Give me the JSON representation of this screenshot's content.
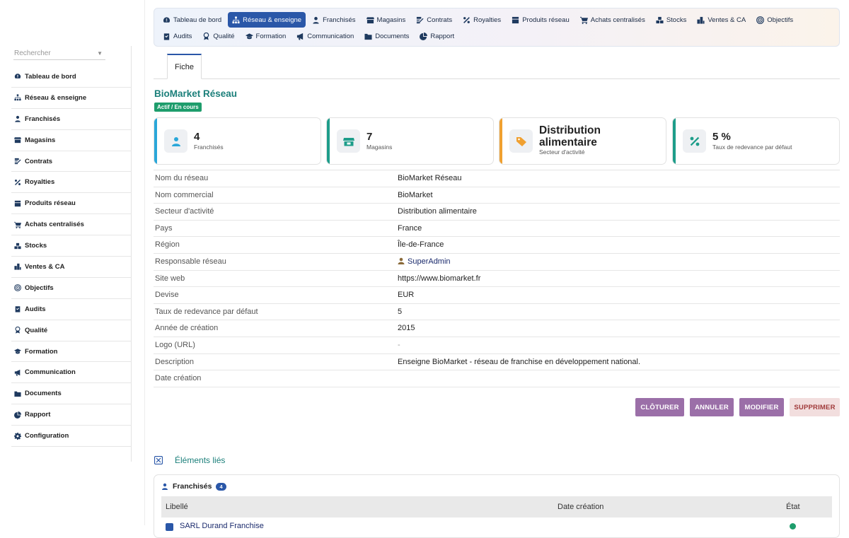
{
  "sidebar": {
    "search_placeholder": "Rechercher",
    "items": [
      {
        "label": "Tableau de bord",
        "icon": "dashboard-icon"
      },
      {
        "label": "Réseau & enseigne",
        "icon": "network-icon"
      },
      {
        "label": "Franchisés",
        "icon": "user-icon"
      },
      {
        "label": "Magasins",
        "icon": "store-icon"
      },
      {
        "label": "Contrats",
        "icon": "contract-icon"
      },
      {
        "label": "Royalties",
        "icon": "percent-icon"
      },
      {
        "label": "Produits réseau",
        "icon": "product-icon"
      },
      {
        "label": "Achats centralisés",
        "icon": "cart-icon"
      },
      {
        "label": "Stocks",
        "icon": "boxes-icon"
      },
      {
        "label": "Ventes & CA",
        "icon": "sales-icon"
      },
      {
        "label": "Objectifs",
        "icon": "target-icon"
      },
      {
        "label": "Audits",
        "icon": "clipboard-icon"
      },
      {
        "label": "Qualité",
        "icon": "award-icon"
      },
      {
        "label": "Formation",
        "icon": "graduation-icon"
      },
      {
        "label": "Communication",
        "icon": "megaphone-icon"
      },
      {
        "label": "Documents",
        "icon": "folder-icon"
      },
      {
        "label": "Rapport",
        "icon": "pie-chart-icon"
      },
      {
        "label": "Configuration",
        "icon": "gear-icon"
      }
    ]
  },
  "topnav": {
    "row1": [
      {
        "label": "Tableau de bord",
        "icon": "dashboard-icon"
      },
      {
        "label": "Réseau & enseigne",
        "icon": "network-icon",
        "active": true
      },
      {
        "label": "Franchisés",
        "icon": "user-icon"
      },
      {
        "label": "Magasins",
        "icon": "store-icon"
      },
      {
        "label": "Contrats",
        "icon": "contract-icon"
      },
      {
        "label": "Royalties",
        "icon": "percent-icon"
      },
      {
        "label": "Produits réseau",
        "icon": "product-icon"
      },
      {
        "label": "Achats centralisés",
        "icon": "cart-icon"
      },
      {
        "label": "Stocks",
        "icon": "boxes-icon"
      },
      {
        "label": "Ventes & CA",
        "icon": "sales-icon"
      },
      {
        "label": "Objectifs",
        "icon": "target-icon"
      }
    ],
    "row2": [
      {
        "label": "Audits",
        "icon": "clipboard-icon"
      },
      {
        "label": "Qualité",
        "icon": "award-icon"
      },
      {
        "label": "Formation",
        "icon": "graduation-icon"
      },
      {
        "label": "Communication",
        "icon": "megaphone-icon"
      },
      {
        "label": "Documents",
        "icon": "folder-icon"
      },
      {
        "label": "Rapport",
        "icon": "pie-chart-icon"
      }
    ]
  },
  "tabs": {
    "fiche": "Fiche"
  },
  "record": {
    "title": "BioMarket Réseau",
    "status": "Actif / En cours"
  },
  "cards": [
    {
      "value": "4",
      "label": "Franchisés",
      "color": "#2aa7d9",
      "icon": "user-icon"
    },
    {
      "value": "7",
      "label": "Magasins",
      "color": "#1e9d8a",
      "icon": "store-icon"
    },
    {
      "value": "Distribution alimentaire",
      "label": "Secteur d'activité",
      "color": "#f0a030",
      "icon": "tag-icon"
    },
    {
      "value": "5 %",
      "label": "Taux de redevance par défaut",
      "color": "#1e9d8a",
      "icon": "percent-icon"
    }
  ],
  "details": [
    {
      "key": "Nom du réseau",
      "value": "BioMarket Réseau"
    },
    {
      "key": "Nom commercial",
      "value": "BioMarket"
    },
    {
      "key": "Secteur d'activité",
      "value": "Distribution alimentaire"
    },
    {
      "key": "Pays",
      "value": "France"
    },
    {
      "key": "Région",
      "value": "Île-de-France"
    },
    {
      "key": "Responsable réseau",
      "value": "SuperAdmin",
      "type": "user"
    },
    {
      "key": "Site web",
      "value": "https://www.biomarket.fr"
    },
    {
      "key": "Devise",
      "value": "EUR"
    },
    {
      "key": "Taux de redevance par défaut",
      "value": "5"
    },
    {
      "key": "Année de création",
      "value": "2015"
    },
    {
      "key": "Logo (URL)",
      "value": "-",
      "type": "muted"
    },
    {
      "key": "Description",
      "value": "Enseigne BioMarket - réseau de franchise en développement national."
    },
    {
      "key": "Date création",
      "value": ""
    }
  ],
  "actions": {
    "close": "CLÔTURER",
    "cancel": "ANNULER",
    "edit": "MODIFIER",
    "delete": "SUPPRIMER"
  },
  "linked": {
    "title": "Éléments liés",
    "panel_title": "Franchisés",
    "count": "4",
    "columns": [
      "Libellé",
      "Date création",
      "État"
    ],
    "first_row": "SARL Durand Franchise"
  },
  "colors": {
    "accent": "#2a57a8",
    "title": "#1b7f7a",
    "status": "#1e9d6c",
    "button": "#9b6fa8"
  }
}
